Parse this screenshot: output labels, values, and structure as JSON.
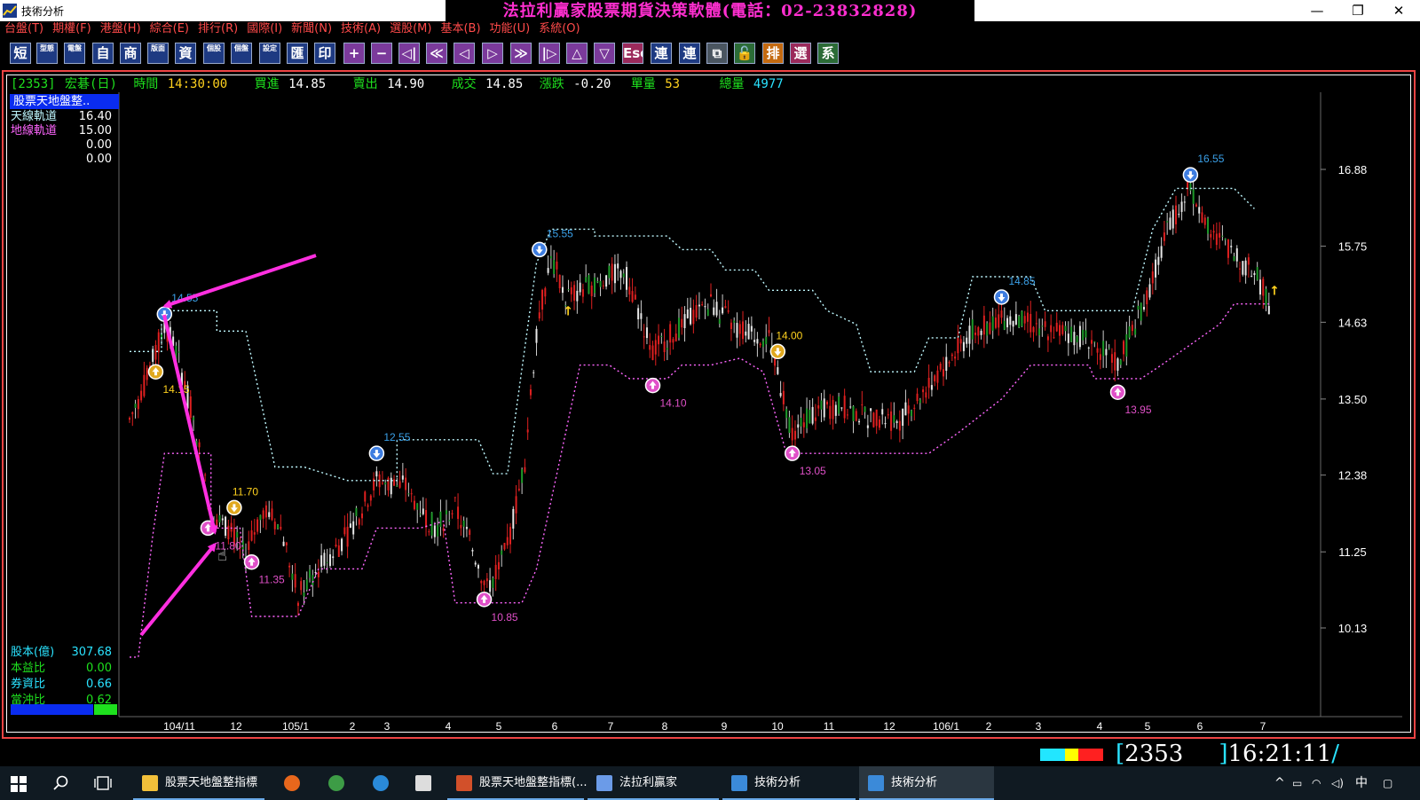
{
  "window": {
    "title": "技術分析",
    "banner": "法拉利贏家股票期貨決策軟體(電話：02-23832828)",
    "minimize": "—",
    "maximize": "❐",
    "close": "✕"
  },
  "menu": [
    "台盤(T)",
    "期權(F)",
    "港盤(H)",
    "綜合(E)",
    "排行(R)",
    "國際(I)",
    "新聞(N)",
    "技術(A)",
    "選股(M)",
    "基本(B)",
    "功能(U)",
    "系統(O)"
  ],
  "toolbar": [
    {
      "label": "短",
      "icon": "short-icon"
    },
    {
      "label": "型態",
      "icon": "pattern-icon"
    },
    {
      "label": "電盤",
      "icon": "board-icon"
    },
    {
      "label": "自",
      "icon": "self-icon"
    },
    {
      "label": "商",
      "icon": "commodity-icon"
    },
    {
      "label": "版面",
      "icon": "layout-icon"
    },
    {
      "label": "資",
      "icon": "data-icon"
    },
    {
      "label": "個股",
      "icon": "stock-icon"
    },
    {
      "label": "個盤",
      "icon": "single-board-icon"
    },
    {
      "label": "設定",
      "icon": "settings-icon"
    },
    {
      "label": "匯",
      "icon": "export-icon"
    },
    {
      "label": "印",
      "icon": "print-icon"
    },
    {
      "label": "+",
      "icon": "zoom-in-icon"
    },
    {
      "label": "−",
      "icon": "zoom-out-icon"
    },
    {
      "label": "◁|",
      "icon": "first-icon"
    },
    {
      "label": "≪",
      "icon": "rewind-icon"
    },
    {
      "label": "◁",
      "icon": "prev-icon"
    },
    {
      "label": "▷",
      "icon": "next-icon"
    },
    {
      "label": "≫",
      "icon": "forward-icon"
    },
    {
      "label": "|▷",
      "icon": "last-icon"
    },
    {
      "label": "△",
      "icon": "up-icon"
    },
    {
      "label": "▽",
      "icon": "down-icon"
    },
    {
      "label": "Esc",
      "icon": "escape-icon"
    },
    {
      "label": "連",
      "icon": "link-icon"
    },
    {
      "label": "連",
      "icon": "link2-icon"
    },
    {
      "label": "⧉",
      "icon": "window-icon"
    },
    {
      "label": "🔓",
      "icon": "unlock-icon"
    },
    {
      "label": "排序",
      "icon": "sort-icon"
    },
    {
      "label": "選股",
      "icon": "select-stock-icon"
    },
    {
      "label": "系統",
      "icon": "system-icon"
    }
  ],
  "quote": {
    "code": "[2353]",
    "name": "宏碁(日)",
    "time_label": "時間",
    "time": "14:30:00",
    "bid_label": "買進",
    "bid": "14.85",
    "ask_label": "賣出",
    "ask": "14.90",
    "trade_label": "成交",
    "trade": "14.85",
    "change_label": "漲跌",
    "change": "-0.20",
    "vol_label": "單量",
    "vol": "53",
    "total_label": "總量",
    "total": "4977"
  },
  "legend": {
    "title": "股票天地盤整..",
    "rows": [
      {
        "label": "天線軌道",
        "value": "16.40",
        "color": "#bff8ff"
      },
      {
        "label": "地線軌道",
        "value": "15.00",
        "color": "#ff66ff"
      },
      {
        "label": "",
        "value": "0.00",
        "color": "#ffffff"
      },
      {
        "label": "",
        "value": "0.00",
        "color": "#ffffff"
      }
    ]
  },
  "fundamentals": [
    {
      "label": "股本(億)",
      "value": "307.68",
      "color": "#2ae3ff"
    },
    {
      "label": "本益比",
      "value": "0.00",
      "color": "#1ee01e"
    },
    {
      "label": "券資比",
      "value": "0.66",
      "color": "#2ae3ff"
    },
    {
      "label": "當沖比",
      "value": "0.62",
      "color": "#1ee01e"
    }
  ],
  "chart_data": {
    "type": "candlestick",
    "y_ticks": [
      "16.88",
      "15.75",
      "14.63",
      "13.50",
      "12.38",
      "11.25",
      "10.13"
    ],
    "x_ticks": [
      "104/11",
      "12",
      "105/1",
      "2",
      "3",
      "4",
      "5",
      "6",
      "7",
      "8",
      "9",
      "10",
      "11",
      "12",
      "106/1",
      "2",
      "3",
      "4",
      "5",
      "6",
      "7"
    ],
    "ylim": [
      9.3,
      17.6
    ],
    "series": [
      {
        "name": "天線軌道",
        "color": "#bff8ff",
        "style": "dotted",
        "points": [
          [
            0,
            14.2
          ],
          [
            11,
            14.2
          ],
          [
            11,
            14.8
          ],
          [
            30,
            14.8
          ],
          [
            30,
            14.5
          ],
          [
            40,
            14.5
          ],
          [
            50,
            12.5
          ],
          [
            60,
            12.5
          ],
          [
            75,
            12.3
          ],
          [
            92,
            12.3
          ],
          [
            92,
            12.9
          ],
          [
            120,
            12.9
          ],
          [
            125,
            12.4
          ],
          [
            130,
            12.4
          ],
          [
            140,
            15.5
          ],
          [
            145,
            16.0
          ],
          [
            160,
            16.0
          ],
          [
            160,
            15.9
          ],
          [
            185,
            15.9
          ],
          [
            190,
            15.7
          ],
          [
            200,
            15.7
          ],
          [
            205,
            15.4
          ],
          [
            215,
            15.4
          ],
          [
            220,
            15.1
          ],
          [
            235,
            15.1
          ],
          [
            240,
            14.8
          ],
          [
            250,
            14.6
          ],
          [
            255,
            13.9
          ],
          [
            270,
            13.9
          ],
          [
            275,
            14.4
          ],
          [
            285,
            14.4
          ],
          [
            290,
            15.3
          ],
          [
            310,
            15.3
          ],
          [
            315,
            14.8
          ],
          [
            345,
            14.8
          ],
          [
            352,
            16.0
          ],
          [
            360,
            16.6
          ],
          [
            380,
            16.6
          ],
          [
            387,
            16.3
          ]
        ]
      },
      {
        "name": "地線軌道",
        "color": "#ff66ff",
        "style": "dotted",
        "points": [
          [
            0,
            9.7
          ],
          [
            3,
            9.7
          ],
          [
            8,
            11.5
          ],
          [
            12,
            12.7
          ],
          [
            28,
            12.7
          ],
          [
            28,
            11.6
          ],
          [
            38,
            11.6
          ],
          [
            42,
            10.3
          ],
          [
            58,
            10.3
          ],
          [
            65,
            11.0
          ],
          [
            80,
            11.0
          ],
          [
            85,
            11.6
          ],
          [
            100,
            11.6
          ],
          [
            108,
            11.7
          ],
          [
            112,
            10.5
          ],
          [
            123,
            10.5
          ],
          [
            135,
            10.5
          ],
          [
            140,
            11.0
          ],
          [
            150,
            13.0
          ],
          [
            155,
            14.0
          ],
          [
            165,
            14.0
          ],
          [
            172,
            13.8
          ],
          [
            185,
            13.8
          ],
          [
            190,
            14.0
          ],
          [
            200,
            14.0
          ],
          [
            210,
            14.1
          ],
          [
            218,
            13.9
          ],
          [
            226,
            12.7
          ],
          [
            275,
            12.7
          ],
          [
            285,
            13.0
          ],
          [
            300,
            13.5
          ],
          [
            310,
            14.0
          ],
          [
            330,
            14.0
          ],
          [
            332,
            13.8
          ],
          [
            348,
            13.8
          ],
          [
            355,
            14.0
          ],
          [
            365,
            14.3
          ],
          [
            375,
            14.6
          ],
          [
            380,
            14.9
          ],
          [
            392,
            14.9
          ]
        ]
      }
    ],
    "markers": [
      {
        "i": 12,
        "price": 14.75,
        "kind": "down",
        "label": "14.55",
        "label_color": "#3aa0e8"
      },
      {
        "i": 9,
        "price": 13.9,
        "kind": "up-gold",
        "label": "14.15",
        "label_color": "#ffd21e"
      },
      {
        "i": 27,
        "price": 11.6,
        "kind": "up",
        "label": "11.80",
        "label_color": "#e050c8"
      },
      {
        "i": 36,
        "price": 11.9,
        "kind": "down-gold",
        "label": "11.70",
        "label_color": "#ffd21e"
      },
      {
        "i": 42,
        "price": 11.1,
        "kind": "up",
        "label": "11.35",
        "label_color": "#e050c8"
      },
      {
        "i": 85,
        "price": 12.7,
        "kind": "down",
        "label": "12.55",
        "label_color": "#3aa0e8"
      },
      {
        "i": 122,
        "price": 10.55,
        "kind": "up",
        "label": "10.85",
        "label_color": "#e050c8"
      },
      {
        "i": 141,
        "price": 15.7,
        "kind": "down",
        "label": "15.55",
        "label_color": "#3aa0e8"
      },
      {
        "i": 180,
        "price": 13.7,
        "kind": "up",
        "label": "14.10",
        "label_color": "#e050c8"
      },
      {
        "i": 223,
        "price": 14.2,
        "kind": "down-gold",
        "label": "14.00",
        "label_color": "#ffd21e"
      },
      {
        "i": 228,
        "price": 12.7,
        "kind": "up",
        "label": "13.05",
        "label_color": "#e050c8"
      },
      {
        "i": 300,
        "price": 15.0,
        "kind": "down",
        "label": "14.85",
        "label_color": "#3aa0e8"
      },
      {
        "i": 340,
        "price": 13.6,
        "kind": "up",
        "label": "13.95",
        "label_color": "#e050c8"
      },
      {
        "i": 365,
        "price": 16.8,
        "kind": "down",
        "label": "16.55",
        "label_color": "#3aa0e8"
      }
    ]
  },
  "status_colors": [
    "#22e6ff",
    "#ffff00",
    "#ff2020"
  ],
  "bottom": {
    "code_open": "[",
    "code": "2353",
    "code_close": "]",
    "clock": "16:21:11"
  },
  "taskbar": {
    "items": [
      {
        "label": "股票天地盤整指標",
        "icon": "folder-icon"
      },
      {
        "label": "",
        "icon": "firefox-icon"
      },
      {
        "label": "",
        "icon": "chrome-icon"
      },
      {
        "label": "",
        "icon": "ie-icon"
      },
      {
        "label": "",
        "icon": "mail-icon"
      },
      {
        "label": "股票天地盤整指標(...",
        "icon": "powerpoint-icon"
      },
      {
        "label": "法拉利贏家",
        "icon": "ferrari-icon"
      },
      {
        "label": "技術分析",
        "icon": "chart-icon"
      },
      {
        "label": "技術分析",
        "icon": "chart-icon"
      }
    ],
    "ime": "中"
  }
}
